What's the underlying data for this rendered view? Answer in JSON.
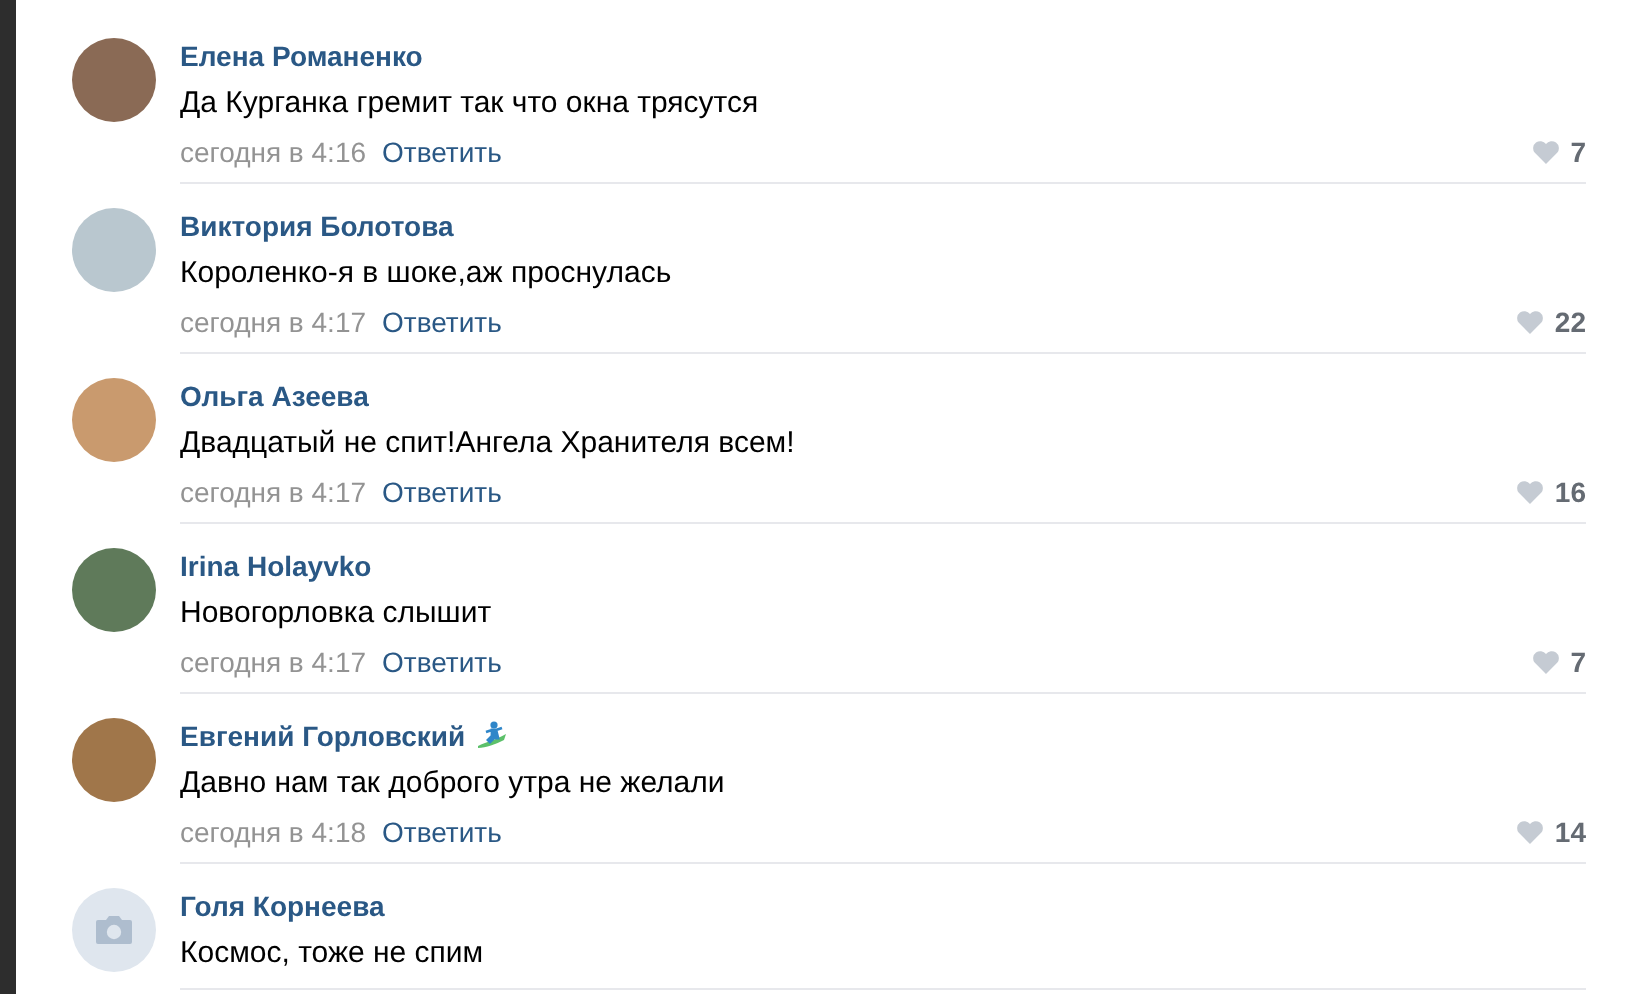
{
  "comments": [
    {
      "author": "Елена Романенко",
      "badge_icon": false,
      "kind": "photo",
      "text": "Да Курганка гремит так что окна трясутся",
      "time": "сегодня в 4:16",
      "reply": "Ответить",
      "likes": "7"
    },
    {
      "author": "Виктория Болотова",
      "badge_icon": false,
      "kind": "photo",
      "text": "Короленко-я в шоке,аж проснулась",
      "time": "сегодня в 4:17",
      "reply": "Ответить",
      "likes": "22"
    },
    {
      "author": "Ольга Азеева",
      "badge_icon": false,
      "kind": "photo",
      "text": "Двадцатый не спит!Ангела Хранителя всем!",
      "time": "сегодня в 4:17",
      "reply": "Ответить",
      "likes": "16"
    },
    {
      "author": "Irina Holayvko",
      "badge_icon": false,
      "kind": "photo",
      "text": "Новогорловка слышит",
      "time": "сегодня в 4:17",
      "reply": "Ответить",
      "likes": "7"
    },
    {
      "author": "Евгений Горловский",
      "badge_icon": true,
      "kind": "photo",
      "text": "Давно нам так доброго утра не желали",
      "time": "сегодня в 4:18",
      "reply": "Ответить",
      "likes": "14"
    },
    {
      "author": "Голя Корнеева",
      "badge_icon": false,
      "kind": "camera",
      "text": "Космос, тоже не спим"
    }
  ]
}
